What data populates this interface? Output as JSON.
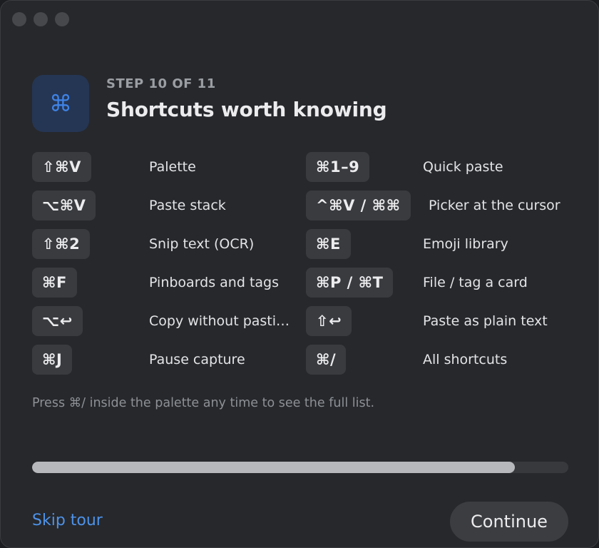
{
  "step_label": "STEP 10 OF 11",
  "title": "Shortcuts worth knowing",
  "hero_icon": "⌘",
  "shortcuts": [
    {
      "keys": "⇧⌘V",
      "label": "Palette"
    },
    {
      "keys": "⌘1–9",
      "label": "Quick paste"
    },
    {
      "keys": "⌥⌘V",
      "label": "Paste stack"
    },
    {
      "keys": "^⌘V / ⌘⌘",
      "label": "Picker at the cursor"
    },
    {
      "keys": "⇧⌘2",
      "label": "Snip text (OCR)"
    },
    {
      "keys": "⌘E",
      "label": "Emoji library"
    },
    {
      "keys": "⌘F",
      "label": "Pinboards and tags"
    },
    {
      "keys": "⌘P / ⌘T",
      "label": "File / tag a card"
    },
    {
      "keys": "⌥↩",
      "label": "Copy without pasti…"
    },
    {
      "keys": "⇧↩",
      "label": "Paste as plain text"
    },
    {
      "keys": "⌘J",
      "label": "Pause capture"
    },
    {
      "keys": "⌘/",
      "label": "All shortcuts"
    }
  ],
  "note": "Press ⌘/ inside the palette any time to see the full list.",
  "progress": 0.9,
  "skip_label": "Skip tour",
  "continue_label": "Continue"
}
